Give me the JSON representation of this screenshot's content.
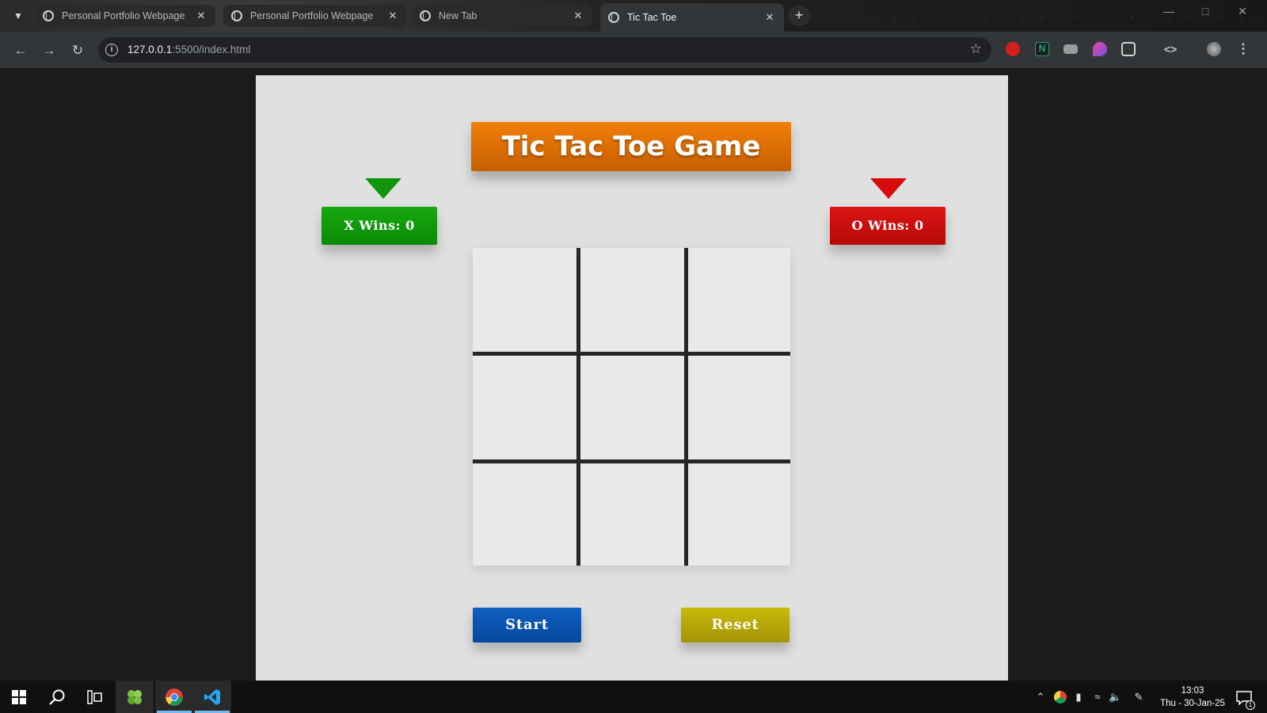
{
  "browser": {
    "tabs": [
      {
        "title": "Personal Portfolio Webpage",
        "active": false
      },
      {
        "title": "Personal Portfolio Webpage",
        "active": false
      },
      {
        "title": "New Tab",
        "active": false
      },
      {
        "title": "Tic Tac Toe",
        "active": true
      }
    ],
    "url": {
      "host": "127.0.0.1",
      "path": ":5500/index.html"
    }
  },
  "game": {
    "title": "Tic Tac Toe Game",
    "x_score_label": "X Wins: 0",
    "o_score_label": "O Wins: 0",
    "board": [
      "",
      "",
      "",
      "",
      "",
      "",
      "",
      "",
      ""
    ],
    "start_label": "Start",
    "reset_label": "Reset",
    "colors": {
      "title": "#e3720a",
      "x": "#10960b",
      "o": "#d70c0c",
      "start": "#0a55b0",
      "reset": "#b8a807",
      "card": "#e0e0e0"
    }
  },
  "taskbar": {
    "time": "13:03",
    "date": "Thu - 30-Jan-25",
    "notification_count": "1"
  }
}
